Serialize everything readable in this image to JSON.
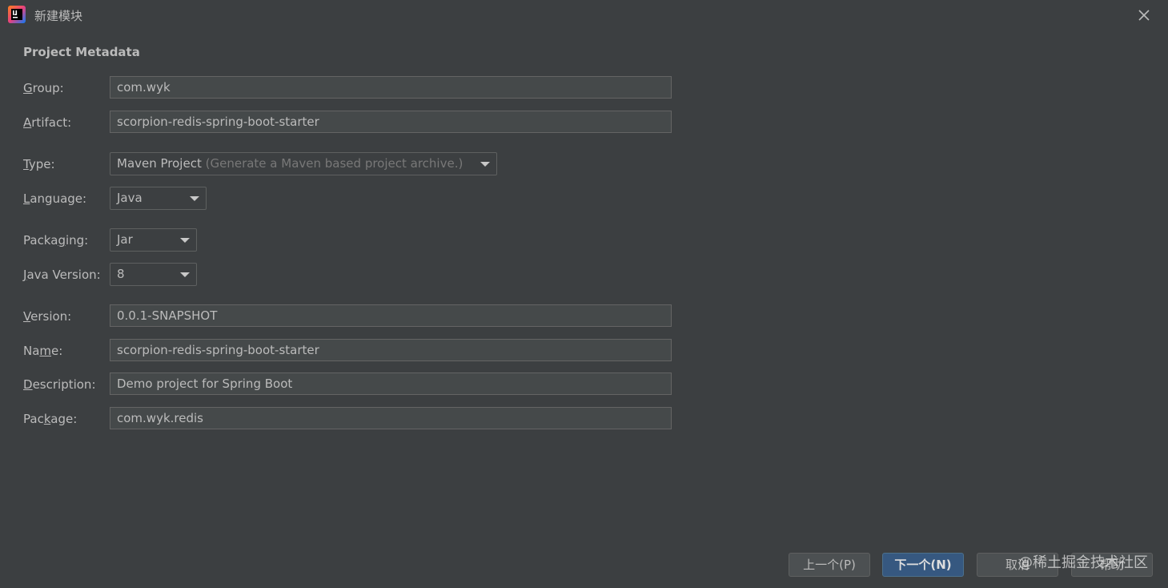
{
  "window": {
    "title": "新建模块",
    "app_icon": "intellij-idea-icon",
    "close_icon": "close-icon"
  },
  "section": {
    "title": "Project Metadata"
  },
  "fields": {
    "group": {
      "label_mn": "G",
      "label_rest": "roup:",
      "value": "com.wyk"
    },
    "artifact": {
      "label_mn": "A",
      "label_rest": "rtifact:",
      "value": "scorpion-redis-spring-boot-starter"
    },
    "type": {
      "label_mn": "T",
      "label_rest": "ype:",
      "value": "Maven Project",
      "hint": "(Generate a Maven based project archive.)"
    },
    "language": {
      "label_mn": "L",
      "label_rest": "anguage:",
      "value": "Java"
    },
    "packaging": {
      "label_pre": "Packa",
      "label_mn": "g",
      "label_rest": "ing:",
      "value": "Jar"
    },
    "java_version": {
      "label_mn": "J",
      "label_rest": "ava Version:",
      "value": "8"
    },
    "version": {
      "label_mn": "V",
      "label_rest": "ersion:",
      "value": "0.0.1-SNAPSHOT"
    },
    "name": {
      "label_pre": "Na",
      "label_mn": "m",
      "label_rest": "e:",
      "value": "scorpion-redis-spring-boot-starter"
    },
    "description": {
      "label_mn": "D",
      "label_rest": "escription:",
      "value": "Demo project for Spring Boot"
    },
    "package": {
      "label_pre": "Pac",
      "label_mn": "k",
      "label_rest": "age:",
      "value": "com.wyk.redis"
    }
  },
  "buttons": {
    "previous": "上一个(P)",
    "next": "下一个(N)",
    "cancel": "取消",
    "help": "帮助"
  },
  "watermark": "@稀土掘金技术社区",
  "colors": {
    "background": "#3c3f41",
    "field_bg": "#45494a",
    "primary_button": "#365880"
  }
}
